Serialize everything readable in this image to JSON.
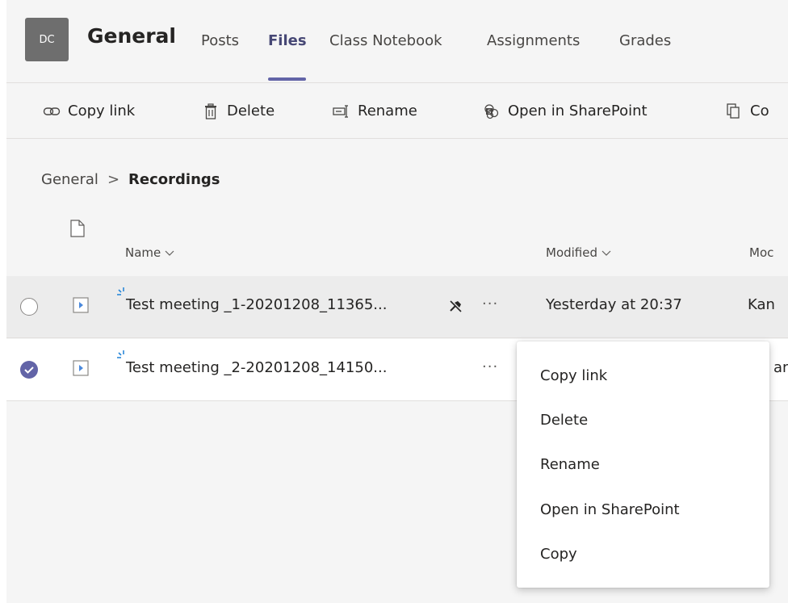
{
  "header": {
    "avatar_initials": "DC",
    "channel_name": "General",
    "tabs": [
      {
        "label": "Posts",
        "active": false
      },
      {
        "label": "Files",
        "active": true
      },
      {
        "label": "Class Notebook",
        "active": false
      },
      {
        "label": "Assignments",
        "active": false
      },
      {
        "label": "Grades",
        "active": false
      }
    ]
  },
  "toolbar": {
    "copy_link": "Copy link",
    "delete": "Delete",
    "rename": "Rename",
    "open_sharepoint": "Open in SharePoint",
    "copy_partial": "Co"
  },
  "breadcrumb": {
    "root": "General",
    "separator": ">",
    "current": "Recordings"
  },
  "table": {
    "columns": {
      "name": "Name",
      "modified": "Modified",
      "modified_by_partial": "Moc"
    },
    "rows": [
      {
        "name": "Test meeting _1-20201208_11365...",
        "modified": "Yesterday at 20:37",
        "modified_by_partial": "Kan",
        "selected": false,
        "more": "···"
      },
      {
        "name": "Test meeting _2-20201208_14150...",
        "modified": "",
        "modified_by_partial": "an",
        "selected": true,
        "more": "···"
      }
    ]
  },
  "context_menu": {
    "items": [
      "Copy link",
      "Delete",
      "Rename",
      "Open in SharePoint",
      "Copy"
    ]
  },
  "colors": {
    "accent": "#6264a7",
    "active_tab_text": "#464775",
    "panel_bg": "#f5f5f5"
  },
  "icons": {
    "copy_link": "link-icon",
    "delete": "trash-icon",
    "rename": "rename-icon",
    "open_sharepoint": "sharepoint-icon",
    "copy": "copy-icon",
    "file_type": "document-icon",
    "video": "video-file-icon",
    "new": "new-sparkle-icon",
    "unsync": "pin-off-icon",
    "sort": "chevron-down-icon",
    "check": "checkmark-icon"
  }
}
